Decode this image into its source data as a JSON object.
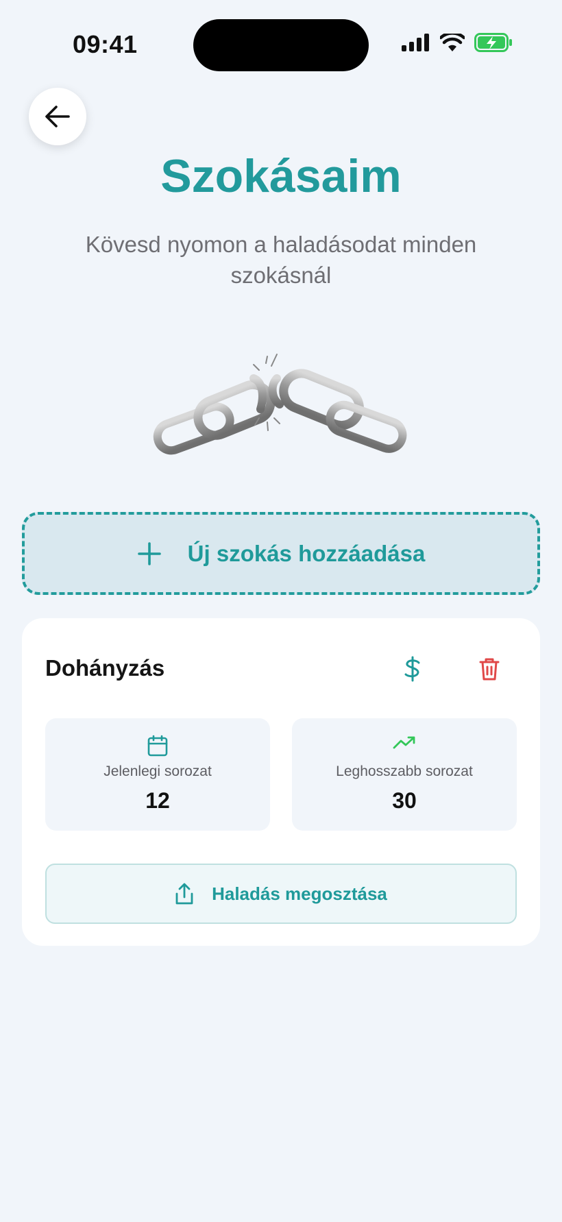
{
  "status_bar": {
    "time": "09:41"
  },
  "header": {
    "title": "Szokásaim",
    "subtitle": "Kövesd nyomon a haladásodat minden szokásnál"
  },
  "add_habit": {
    "label": "Új szokás hozzáadása",
    "icon": "plus-icon"
  },
  "habit": {
    "name": "Dohányzás",
    "current_streak": {
      "label": "Jelenlegi sorozat",
      "value": "12",
      "icon": "calendar-icon"
    },
    "longest_streak": {
      "label": "Leghosszabb sorozat",
      "value": "30",
      "icon": "trending-up-icon"
    },
    "share_label": "Haladás megosztása"
  },
  "colors": {
    "accent": "#229a9c",
    "danger": "#e04848",
    "success": "#34c759",
    "background": "#f1f5fa"
  }
}
